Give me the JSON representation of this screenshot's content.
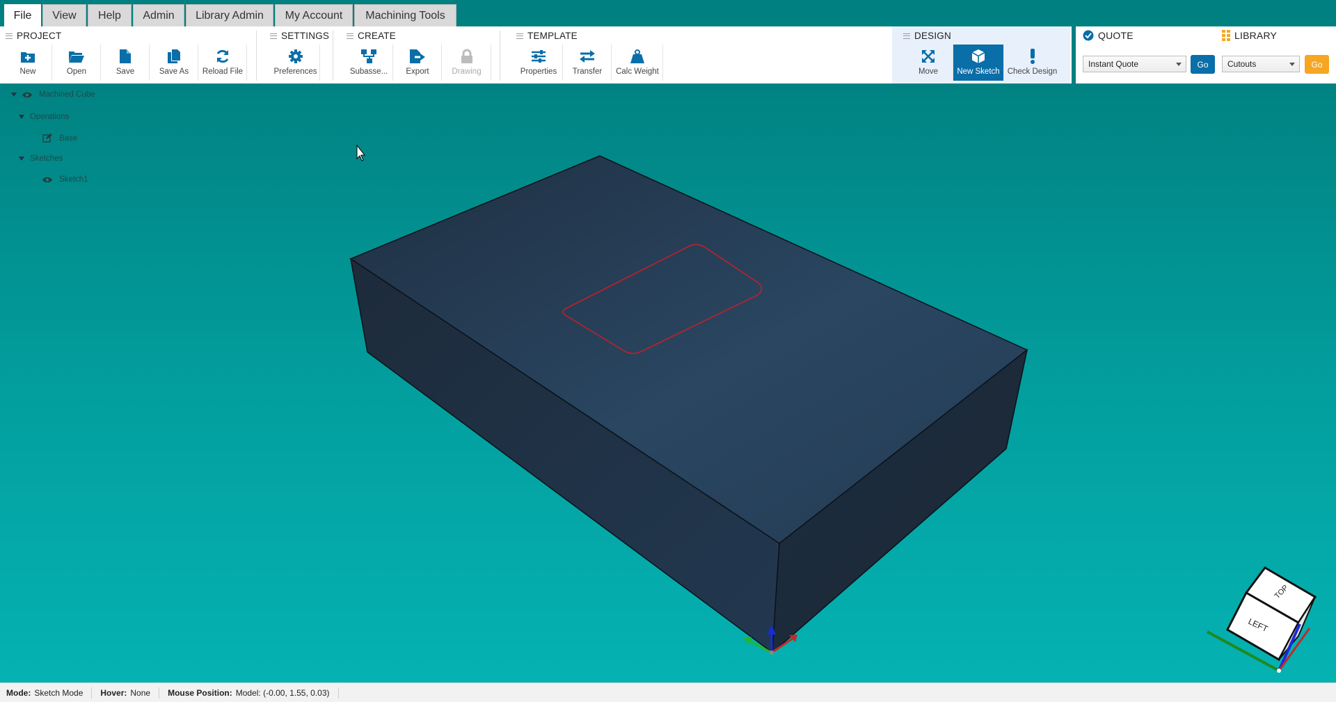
{
  "tabs": [
    {
      "label": "File",
      "active": true
    },
    {
      "label": "View",
      "active": false
    },
    {
      "label": "Help",
      "active": false
    },
    {
      "label": "Admin",
      "active": false
    },
    {
      "label": "Library Admin",
      "active": false
    },
    {
      "label": "My Account",
      "active": false
    },
    {
      "label": "Machining Tools",
      "active": false
    }
  ],
  "ribbon": {
    "project": {
      "title": "PROJECT",
      "buttons": [
        "New",
        "Open",
        "Save",
        "Save As",
        "Reload File"
      ]
    },
    "settings": {
      "title": "SETTINGS",
      "buttons": [
        "Preferences"
      ]
    },
    "create": {
      "title": "CREATE",
      "buttons": [
        "Subasse...",
        "Export",
        "Drawing"
      ]
    },
    "template": {
      "title": "TEMPLATE",
      "buttons": [
        "Properties",
        "Transfer",
        "Calc Weight"
      ]
    },
    "design": {
      "title": "DESIGN",
      "buttons": [
        "Move",
        "New Sketch",
        "Check Design"
      ]
    },
    "quote": {
      "title": "QUOTE",
      "selected": "Instant Quote",
      "go": "Go"
    },
    "library": {
      "title": "LIBRARY",
      "selected": "Cutouts",
      "go": "Go"
    }
  },
  "colors": {
    "teal_bg": "#008080",
    "ribbon_highlight": "#0a6ea8",
    "go_blue": "#0a6ea8",
    "go_orange": "#f5a623",
    "model_face": "#253a50",
    "sketch_outline": "#c0202a"
  },
  "tree": {
    "root": "Machined Cube",
    "operations_label": "Operations",
    "operations": [
      "Base"
    ],
    "sketches_label": "Sketches",
    "sketches": [
      "Sketch1"
    ]
  },
  "viewcube": {
    "top": "TOP",
    "left": "LEFT"
  },
  "status": {
    "mode_label": "Mode:",
    "mode": "Sketch Mode",
    "hover_label": "Hover:",
    "hover": "None",
    "mouse_label": "Mouse Position:",
    "mouse": "Model: (-0.00, 1.55, 0.03)"
  }
}
